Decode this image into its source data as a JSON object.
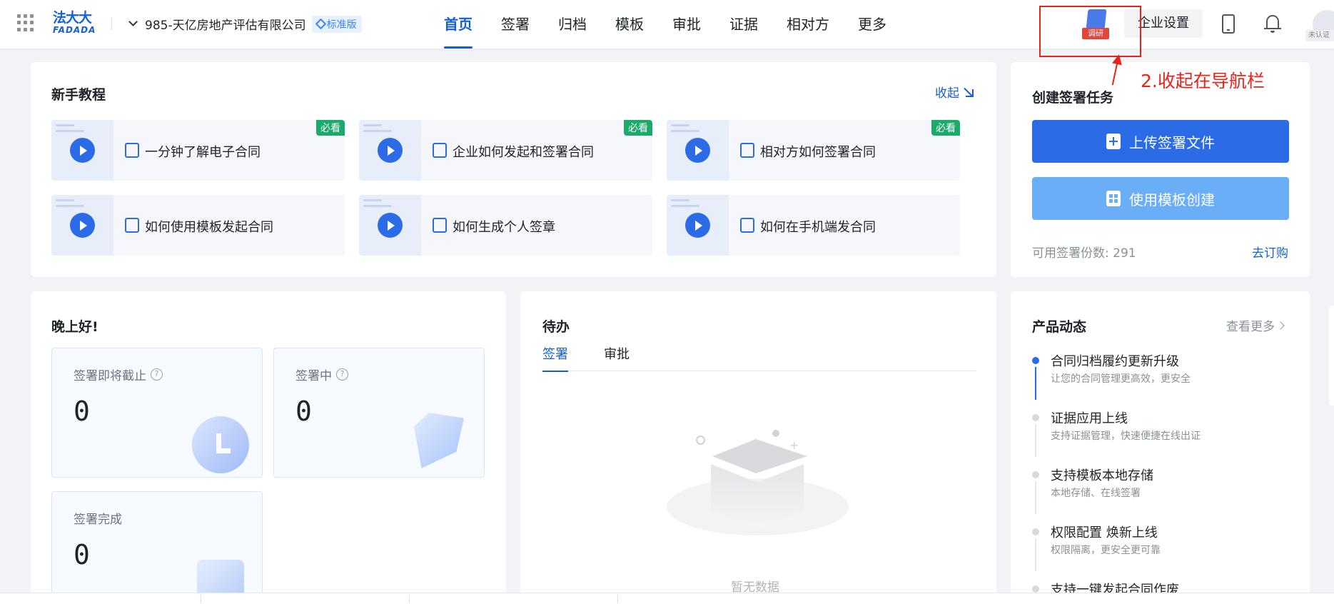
{
  "header": {
    "logo_line1": "法大大",
    "logo_line2": "FADADA",
    "company": "985-天亿房地产评估有限公司",
    "edition_badge": "标准版",
    "nav": [
      "首页",
      "签署",
      "归档",
      "模板",
      "审批",
      "证据",
      "相对方",
      "更多"
    ],
    "active_nav": "首页",
    "survey_label": "调研",
    "enterprise_settings": "企业设置",
    "unauth_badge": "未认证",
    "accent_color": "#1560d4"
  },
  "annotation": {
    "text": "2.收起在导航栏",
    "color": "#e8231a"
  },
  "tutorial": {
    "title": "新手教程",
    "collapse_label": "收起",
    "must_see": "必看",
    "items": [
      {
        "label": "一分钟了解电子合同",
        "must": true
      },
      {
        "label": "企业如何发起和签署合同",
        "must": true
      },
      {
        "label": "相对方如何签署合同",
        "must": true
      },
      {
        "label": "如何使用模板发起合同",
        "must": false
      },
      {
        "label": "如何生成个人签章",
        "must": false
      },
      {
        "label": "如何在手机端发合同",
        "must": false
      }
    ]
  },
  "create_task": {
    "title": "创建签署任务",
    "upload_label": "上传签署文件",
    "template_label": "使用模板创建",
    "available_label": "可用签署份数: 291",
    "buy_label": "去订购"
  },
  "greeting": {
    "title": "晚上好!",
    "stats": [
      {
        "label": "签署即将截止",
        "value": "0",
        "help": true
      },
      {
        "label": "签署中",
        "value": "0",
        "help": true
      },
      {
        "label": "签署完成",
        "value": "0",
        "help": false
      }
    ],
    "help_icon_glyph": "?"
  },
  "todo": {
    "title": "待办",
    "tabs": [
      "签署",
      "审批"
    ],
    "active_tab": "签署",
    "empty_text": "暂无数据",
    "empty_plus": "+"
  },
  "news": {
    "title": "产品动态",
    "more_label": "查看更多",
    "items": [
      {
        "title": "合同归档履约更新升级",
        "desc": "让您的合同管理更高效，更安全",
        "active": true
      },
      {
        "title": "证据应用上线",
        "desc": "支持证据管理，快速便捷在线出证",
        "active": false
      },
      {
        "title": "支持模板本地存储",
        "desc": "本地存储、在线签署",
        "active": false
      },
      {
        "title": "权限配置 焕新上线",
        "desc": "权限隔离，更安全更可靠",
        "active": false
      },
      {
        "title": "支持一键发起合同作废",
        "desc": "",
        "active": false
      }
    ]
  }
}
